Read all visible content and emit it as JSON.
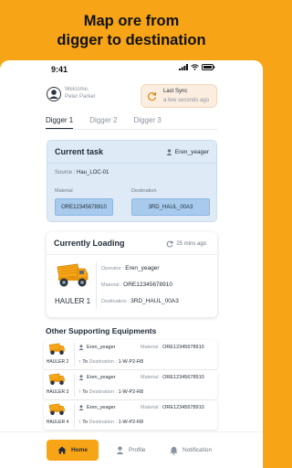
{
  "headline": {
    "line1": "Map ore from",
    "line2": "digger to destination"
  },
  "status_bar": {
    "time": "9:41"
  },
  "user": {
    "welcome": "Welcome,",
    "name": "Peter Parker"
  },
  "sync": {
    "label": "Last Sync",
    "time": "a few seconds ago"
  },
  "tabs": [
    {
      "label": "Digger 1",
      "active": true
    },
    {
      "label": "Digger 2",
      "active": false
    },
    {
      "label": "Digger 3",
      "active": false
    }
  ],
  "current_task": {
    "title": "Current task",
    "operator": "Eren_yeager",
    "source_label": "Source :",
    "source": "Hau_LOC-01",
    "material_label": "Material",
    "material": "ORE12345678910",
    "destination_label": "Destination",
    "destination": "3RD_HAUL_00A3"
  },
  "current_loading": {
    "title": "Currently Loading",
    "ago": "25 mins ago",
    "hauler": "HAULER 1",
    "operator_label": "Operator :",
    "operator": "Eren_yeager",
    "material_label": "Material :",
    "material": "ORE12345678910",
    "destination_label": "Destination :",
    "destination": "3RD_HAUL_00A3"
  },
  "other": {
    "title": "Other Supporting Equipments",
    "material_label": "Material :",
    "to_label": "To",
    "destination_label": "Destination :",
    "items": [
      {
        "hauler": "HAULER 2",
        "operator": "Eren_yeager",
        "material": "ORE12345678910",
        "destination": "1-W-P2-R8"
      },
      {
        "hauler": "HAULER 3",
        "operator": "Eren_yeager",
        "material": "ORE12345678910",
        "destination": "1-W-P2-R8"
      },
      {
        "hauler": "HAULER 4",
        "operator": "Eren_yeager",
        "material": "ORE12345678910",
        "destination": "1-W-P2-R8"
      }
    ]
  },
  "nav": {
    "home": "Home",
    "profile": "Profile",
    "notification": "Notification"
  },
  "colors": {
    "accent": "#f7a516",
    "task_card": "#deebf7",
    "chip": "#a8cbed",
    "arrow": "#e02020"
  },
  "icons": {
    "avatar": "user-avatar-icon",
    "sync": "sync-icon",
    "operator": "person-icon",
    "truck": "dump-truck-icon",
    "home": "home-icon",
    "profile": "profile-icon",
    "notification": "bell-icon"
  }
}
